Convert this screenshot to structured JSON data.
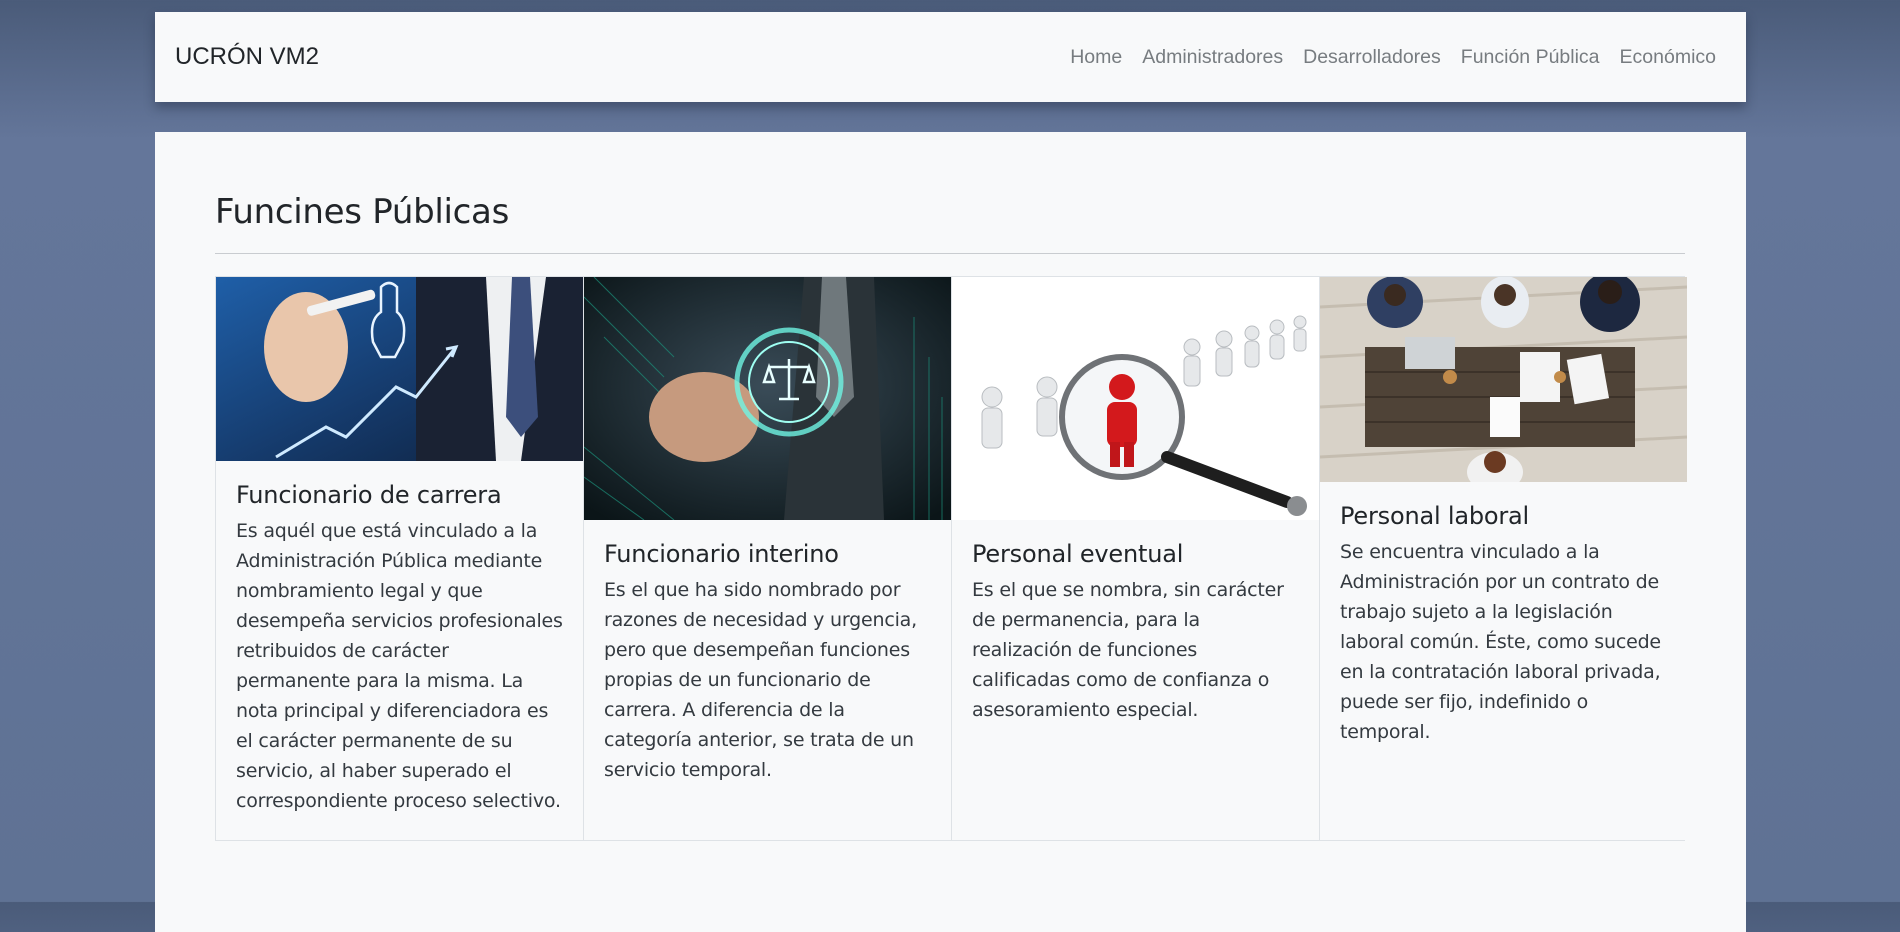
{
  "navbar": {
    "brand": "UCRÓN VM2",
    "links": [
      "Home",
      "Administradores",
      "Desarrolladores",
      "Función Pública",
      "Económico"
    ]
  },
  "main": {
    "title": "Funcines Públicas",
    "cards": [
      {
        "image": "career-growth-chart-image",
        "title": "Funcionario de carrera",
        "text": "Es aquél que está vinculado a la Administración Pública mediante nombramiento legal y que desempeña servicios profesionales retribuidos de carácter permanente para la misma. La nota principal y diferenciadora es el carácter permanente de su servicio, al haber superado el correspondiente proceso selectivo."
      },
      {
        "image": "justice-scales-touch-image",
        "title": "Funcionario interino",
        "text": "Es el que ha sido nombrado por razones de necesidad y urgencia, pero que desempeñan funciones propias de un funcionario de carrera. A diferencia de la categoría anterior, se trata de un servicio temporal."
      },
      {
        "image": "magnifier-selection-image",
        "title": "Personal eventual",
        "text": "Es el que se nombra, sin carácter de permanencia, para la realización de funciones calificadas como de confianza o asesoramiento especial."
      },
      {
        "image": "office-meeting-table-image",
        "title": "Personal laboral",
        "text": "Se encuentra vinculado a la Administración por un contrato de trabajo sujeto a la legislación laboral común. Éste, como sucede en la contratación laboral privada, puede ser fijo, indefinido o temporal."
      }
    ]
  }
}
